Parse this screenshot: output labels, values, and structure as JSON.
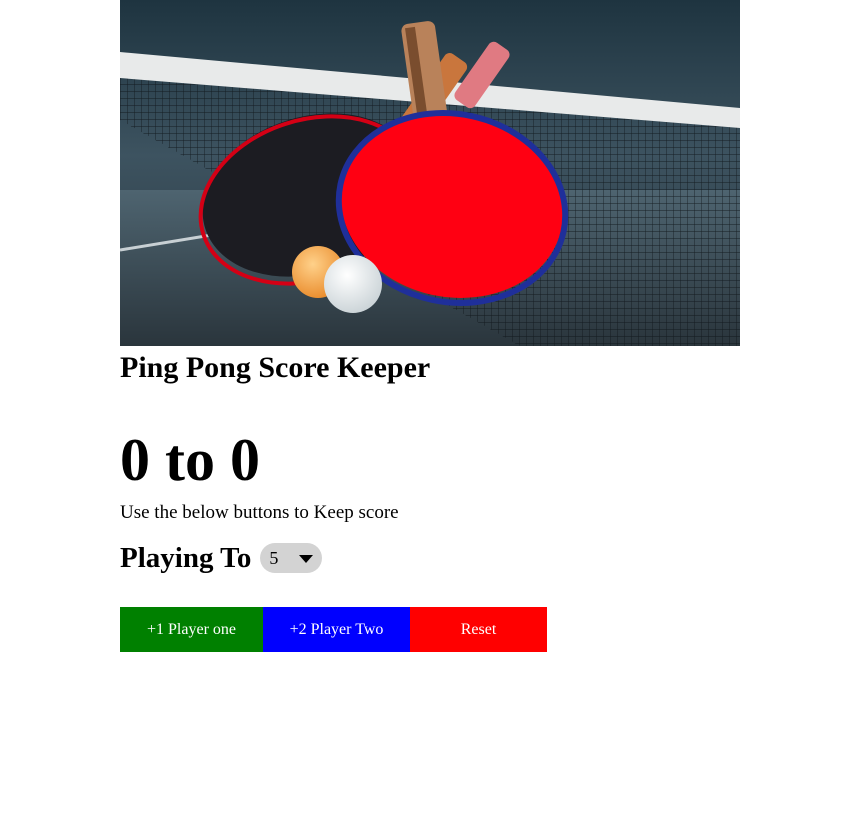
{
  "hero": {
    "image": "ping-pong-paddles-photo"
  },
  "title": "Ping Pong Score Keeper",
  "score": {
    "player_one": "0",
    "separator": "to",
    "player_two": "0"
  },
  "hint": "Use the below buttons to Keep score",
  "playing_to": {
    "label": "Playing To",
    "selected": "5"
  },
  "buttons": {
    "player_one": {
      "label": "+1 Player one",
      "color": "#008000"
    },
    "player_two": {
      "label": "+2 Player Two",
      "color": "#0000ff"
    },
    "reset": {
      "label": "Reset",
      "color": "#ff0000"
    }
  }
}
